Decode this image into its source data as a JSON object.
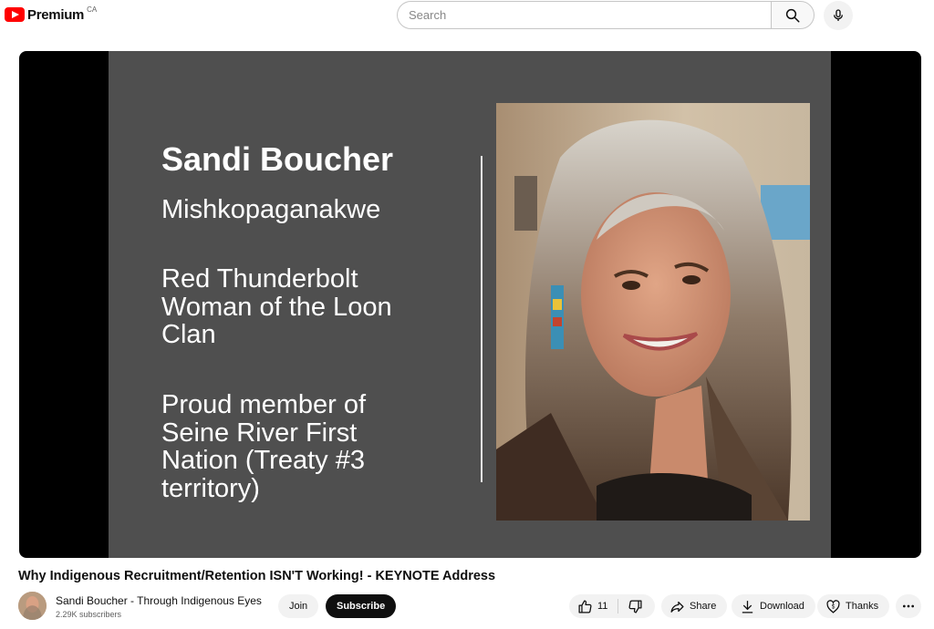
{
  "header": {
    "logo_text": "Premium",
    "country_code": "CA",
    "search": {
      "placeholder": "Search",
      "value": ""
    }
  },
  "slide": {
    "name": "Sandi Boucher",
    "subtitle": "Mishkopaganakwe",
    "block1": [
      "Red Thunderbolt",
      "Woman of the Loon",
      "Clan"
    ],
    "block2": [
      "Proud member of",
      "Seine River First",
      "Nation (Treaty #3",
      "territory)"
    ]
  },
  "video": {
    "title": "Why Indigenous Recruitment/Retention ISN'T Working! - KEYNOTE Address"
  },
  "channel": {
    "name": "Sandi Boucher - Through Indigenous Eyes",
    "subscribers": "2.29K subscribers",
    "join_label": "Join",
    "subscribe_label": "Subscribe"
  },
  "actions": {
    "like_count": "11",
    "share_label": "Share",
    "download_label": "Download",
    "thanks_label": "Thanks"
  },
  "colors": {
    "brand_red": "#ff0000",
    "slide_bg": "#4f4f4f",
    "pill_bg": "#f2f2f2",
    "subscribe_bg": "#0f0f0f"
  },
  "icons": [
    "youtube-logo-icon",
    "search-icon",
    "mic-icon",
    "thumbs-up-icon",
    "thumbs-down-icon",
    "share-icon",
    "download-icon",
    "thanks-icon",
    "more-icon"
  ]
}
